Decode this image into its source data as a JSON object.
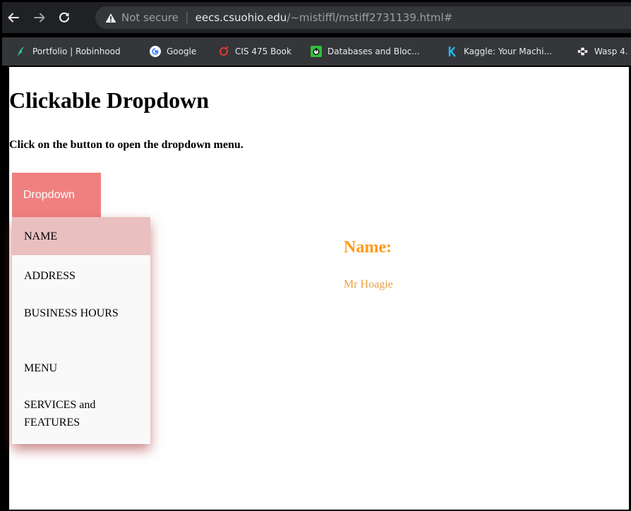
{
  "browser": {
    "security_label": "Not secure",
    "url_host": "eecs.csuohio.edu",
    "url_path": "/~mistiffl/mstiff2731139.html#",
    "bookmarks": [
      {
        "label": "Portfolio | Robinhood",
        "icon": "robinhood-feather-icon",
        "color": "#21ce99"
      },
      {
        "label": "Google",
        "icon": "google-icon",
        "color": "#4285f4"
      },
      {
        "label": "CIS 475 Book",
        "icon": "book-site-icon",
        "color": "#e53935"
      },
      {
        "label": "Databases and Bloc...",
        "icon": "power-icon",
        "color": "#2fbf3a"
      },
      {
        "label": "Kaggle: Your Machi...",
        "icon": "kaggle-icon",
        "color": "#20beff"
      },
      {
        "label": "Wasp 4.",
        "icon": "wasp-icon",
        "color": "#ffffff"
      }
    ]
  },
  "page": {
    "title": "Clickable Dropdown",
    "subtitle": "Click on the button to open the dropdown menu.",
    "dropdown_button": "Dropdown",
    "dropdown_items": [
      {
        "label": "NAME"
      },
      {
        "label": "ADDRESS"
      },
      {
        "label": "BUSINESS HOURS"
      },
      {
        "label": "MENU"
      },
      {
        "label": "SERVICES and FEATURES"
      }
    ],
    "active_item_index": 0,
    "detail": {
      "heading": "Name:",
      "value": "Mr Hoagie"
    }
  },
  "colors": {
    "button_bg": "#f08080",
    "active_item_bg": "#eabfbf",
    "menu_bg": "#f9f9f9",
    "detail_heading": "#ff9a1a",
    "detail_value": "#e6a040"
  }
}
